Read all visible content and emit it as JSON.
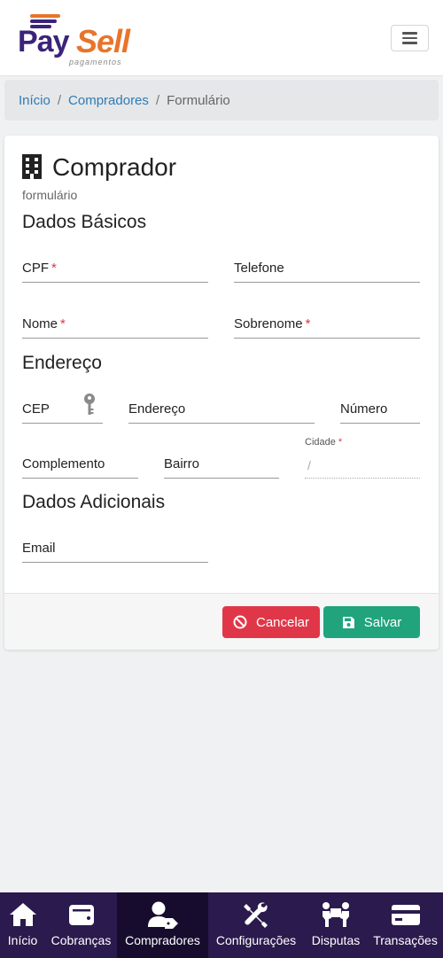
{
  "logo": {
    "pay": "Pay",
    "sell": "Sell",
    "sub": "pagamentos"
  },
  "breadcrumb": {
    "home": "Início",
    "buyers": "Compradores",
    "current": "Formulário",
    "separator": "/"
  },
  "page": {
    "title": "Comprador",
    "subtitle": "formulário"
  },
  "sections": {
    "basic": "Dados Básicos",
    "address": "Endereço",
    "extra": "Dados Adicionais"
  },
  "fields": {
    "cpf": "CPF",
    "phone": "Telefone",
    "name": "Nome",
    "surname": "Sobrenome",
    "cep": "CEP",
    "address": "Endereço",
    "number": "Número",
    "complement": "Complemento",
    "district": "Bairro",
    "city": "Cidade",
    "city_value": "/",
    "email": "Email",
    "required_mark": "*"
  },
  "actions": {
    "cancel": "Cancelar",
    "save": "Salvar"
  },
  "nav": [
    {
      "label": "Início",
      "icon": "home-icon"
    },
    {
      "label": "Cobranças",
      "icon": "wallet-icon"
    },
    {
      "label": "Compradores",
      "icon": "user-tag-icon",
      "active": true
    },
    {
      "label": "Configurações",
      "icon": "tools-icon"
    },
    {
      "label": "Disputas",
      "icon": "people-carry-icon"
    },
    {
      "label": "Transações",
      "icon": "credit-card-icon"
    }
  ],
  "colors": {
    "brand_primary": "#3b2479",
    "brand_accent": "#e8742a",
    "cancel": "#e03748",
    "save": "#21a47b",
    "nav_bg": "#2b1a4d",
    "nav_active": "#170c2e",
    "link": "#2f7bb5",
    "required": "#dc3545"
  }
}
